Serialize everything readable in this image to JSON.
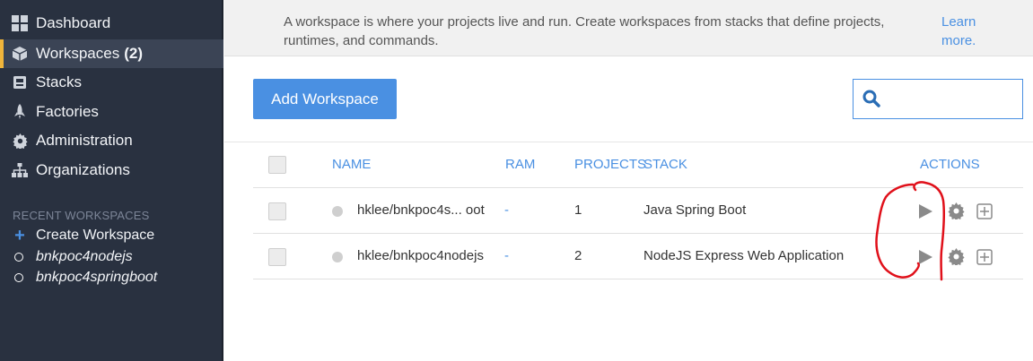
{
  "sidebar": {
    "items": [
      {
        "label": "Dashboard",
        "icon": "dashboard-icon"
      },
      {
        "label": "Workspaces",
        "count": "(2)",
        "icon": "cube-icon"
      },
      {
        "label": "Stacks",
        "icon": "stack-icon"
      },
      {
        "label": "Factories",
        "icon": "rocket-icon"
      },
      {
        "label": "Administration",
        "icon": "gear-icon"
      },
      {
        "label": "Organizations",
        "icon": "sitemap-icon"
      }
    ],
    "recent_title": "RECENT WORKSPACES",
    "create_label": "Create Workspace",
    "recent": [
      "bnkpoc4nodejs",
      "bnkpoc4springboot"
    ]
  },
  "info": {
    "text": "A workspace is where your projects live and run. Create workspaces from stacks that define projects, runtimes, and commands.",
    "link": "Learn more."
  },
  "toolbar": {
    "add_label": "Add Workspace",
    "search_placeholder": ""
  },
  "table": {
    "headers": {
      "name": "NAME",
      "ram": "RAM",
      "projects": "PROJECTS",
      "stack": "STACK",
      "actions": "ACTIONS"
    },
    "rows": [
      {
        "name": "hklee/bnkpoc4s... oot",
        "ram": "-",
        "projects": "1",
        "stack": "Java Spring Boot"
      },
      {
        "name": "hklee/bnkpoc4nodejs",
        "ram": "-",
        "projects": "2",
        "stack": "NodeJS Express Web Application"
      }
    ]
  },
  "colors": {
    "accent": "#4a90e2",
    "sidebar": "#293140",
    "active_marker": "#f0b53b",
    "annotation": "#e0101a"
  }
}
